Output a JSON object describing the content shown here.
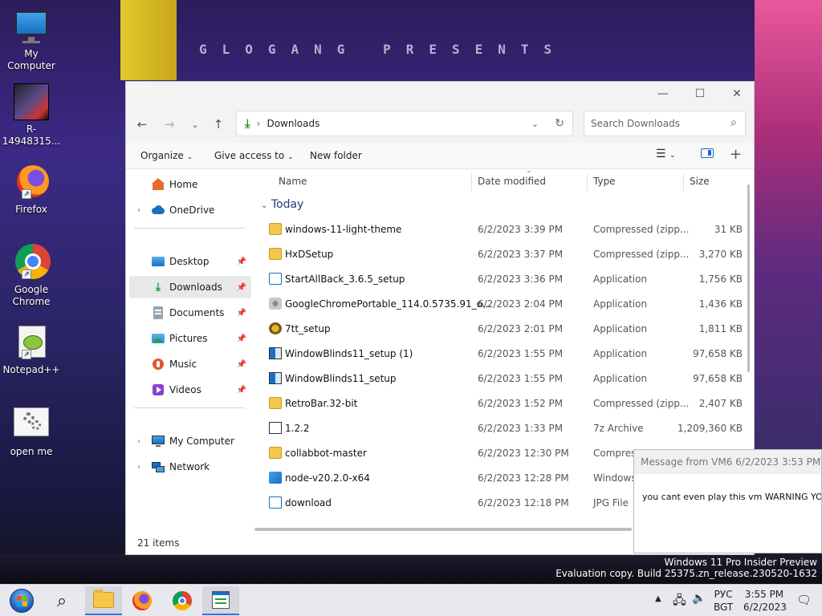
{
  "wallpaper": {
    "top_text": "GLOGANG PRESENTS"
  },
  "desktop": {
    "icons": [
      {
        "label": "My Computer",
        "icon": "monitor-icon"
      },
      {
        "label": "R-14948315...",
        "icon": "album-art-icon"
      },
      {
        "label": "Firefox",
        "icon": "firefox-icon"
      },
      {
        "label": "Google Chrome",
        "icon": "chrome-icon"
      },
      {
        "label": "Notepad++",
        "icon": "notepadpp-icon"
      },
      {
        "label": "open me",
        "icon": "gears-file-icon"
      }
    ]
  },
  "explorer": {
    "address": "Downloads",
    "search_placeholder": "Search Downloads",
    "toolbar": {
      "organize": "Organize",
      "give_access": "Give access to",
      "new_folder": "New folder"
    },
    "sidebar": {
      "home": "Home",
      "onedrive": "OneDrive",
      "quick": [
        {
          "label": "Desktop",
          "icon": "desktop-icon"
        },
        {
          "label": "Downloads",
          "icon": "downloads-icon"
        },
        {
          "label": "Documents",
          "icon": "documents-icon"
        },
        {
          "label": "Pictures",
          "icon": "pictures-icon"
        },
        {
          "label": "Music",
          "icon": "music-icon"
        },
        {
          "label": "Videos",
          "icon": "videos-icon"
        }
      ],
      "my_computer": "My Computer",
      "network": "Network"
    },
    "columns": {
      "name": "Name",
      "date": "Date modified",
      "type": "Type",
      "size": "Size"
    },
    "group": "Today",
    "files": [
      {
        "name": "windows-11-light-theme",
        "date": "6/2/2023 3:39 PM",
        "type": "Compressed (zipp...",
        "size": "31 KB",
        "icon": "zip-folder-icon"
      },
      {
        "name": "HxDSetup",
        "date": "6/2/2023 3:37 PM",
        "type": "Compressed (zipp...",
        "size": "3,270 KB",
        "icon": "zip-folder-icon"
      },
      {
        "name": "StartAllBack_3.6.5_setup",
        "date": "6/2/2023 3:36 PM",
        "type": "Application",
        "size": "1,756 KB",
        "icon": "app-icon"
      },
      {
        "name": "GoogleChromePortable_114.0.5735.91_o...",
        "date": "6/2/2023 2:04 PM",
        "type": "Application",
        "size": "1,436 KB",
        "icon": "installer-icon"
      },
      {
        "name": "7tt_setup",
        "date": "6/2/2023 2:01 PM",
        "type": "Application",
        "size": "1,811 KB",
        "icon": "setup-icon"
      },
      {
        "name": "WindowBlinds11_setup (1)",
        "date": "6/2/2023 1:55 PM",
        "type": "Application",
        "size": "97,658 KB",
        "icon": "windowblinds-icon"
      },
      {
        "name": "WindowBlinds11_setup",
        "date": "6/2/2023 1:55 PM",
        "type": "Application",
        "size": "97,658 KB",
        "icon": "windowblinds-icon"
      },
      {
        "name": "RetroBar.32-bit",
        "date": "6/2/2023 1:52 PM",
        "type": "Compressed (zipp...",
        "size": "2,407 KB",
        "icon": "zip-folder-icon"
      },
      {
        "name": "1.2.2",
        "date": "6/2/2023 1:33 PM",
        "type": "7z Archive",
        "size": "1,209,360 KB",
        "icon": "7z-icon"
      },
      {
        "name": "collabbot-master",
        "date": "6/2/2023 12:30 PM",
        "type": "Compress",
        "size": "",
        "icon": "zip-folder-icon"
      },
      {
        "name": "node-v20.2.0-x64",
        "date": "6/2/2023 12:28 PM",
        "type": "Windows",
        "size": "",
        "icon": "msi-icon"
      },
      {
        "name": "download",
        "date": "6/2/2023 12:18 PM",
        "type": "JPG File",
        "size": "",
        "icon": "image-file-icon"
      }
    ],
    "status": "21 items"
  },
  "message": {
    "title": "Message from VM6 6/2/2023 3:53 PM",
    "body": "you cant even play this vm WARNING YOU S"
  },
  "watermark": {
    "line1": "Windows 11 Pro Insider Preview",
    "line2": "Evaluation copy. Build 25375.zn_release.230520-1632"
  },
  "taskbar": {
    "lang": "РУС",
    "layout": "BGT",
    "time": "3:55 PM",
    "date": "6/2/2023"
  },
  "colors": {
    "accent": "#3a6fd8",
    "folder": "#f5c84c",
    "download_arrow": "#1f9d3a"
  }
}
